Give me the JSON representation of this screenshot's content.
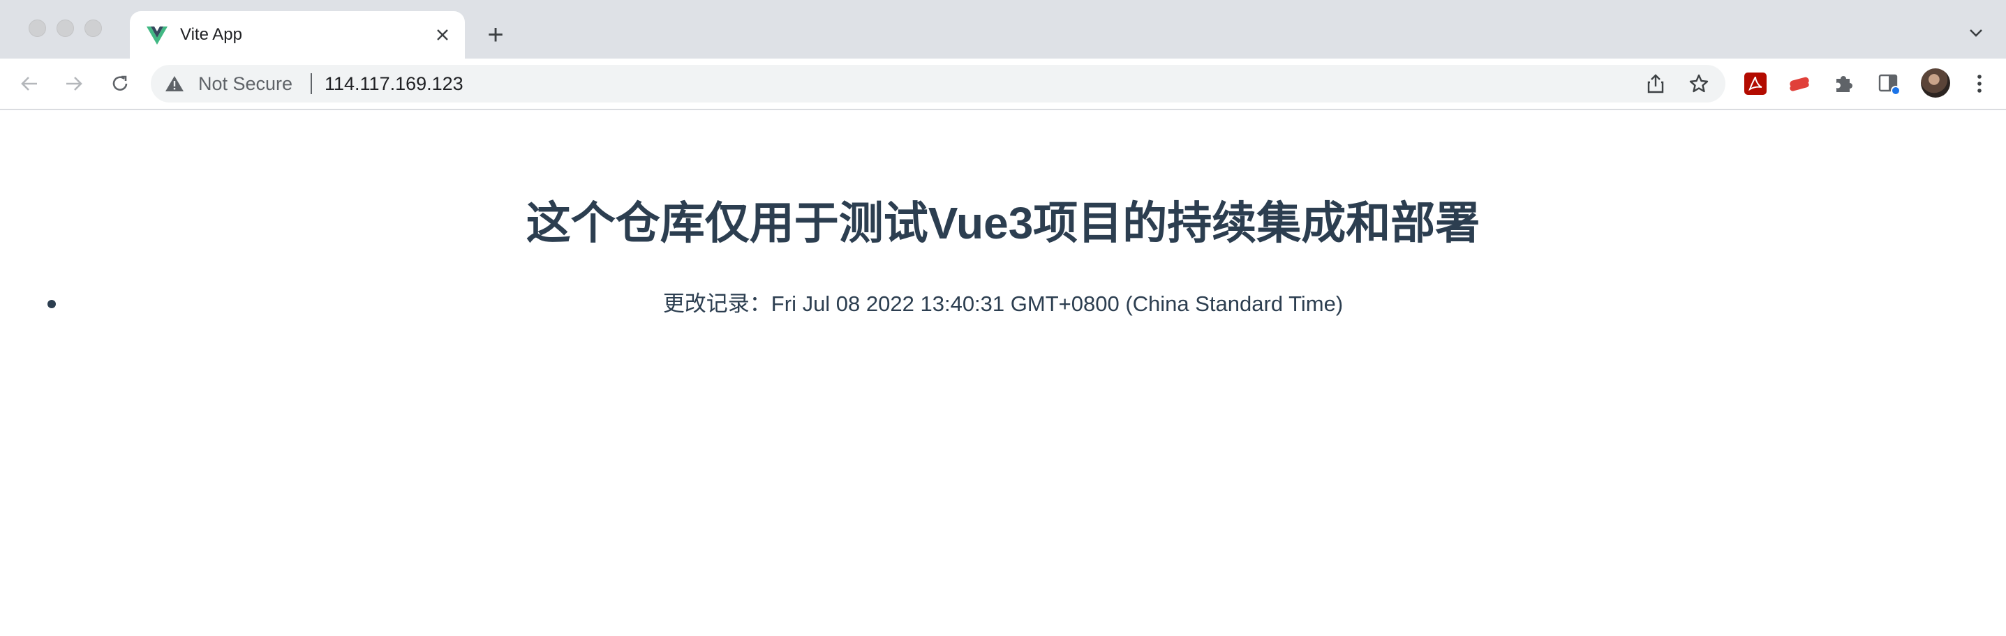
{
  "browser": {
    "tab": {
      "title": "Vite App",
      "favicon": "vue-logo-icon",
      "close_icon": "close-icon"
    },
    "new_tab_label": "+",
    "tab_menu_icon": "chevron-down-icon",
    "nav": {
      "back_icon": "back-arrow-icon",
      "forward_icon": "forward-arrow-icon",
      "reload_icon": "reload-icon"
    },
    "omnibox": {
      "security_label": "Not Secure",
      "security_icon": "warning-icon",
      "url": "114.117.169.123",
      "share_icon": "share-icon",
      "bookmark_icon": "star-icon"
    },
    "extensions": [
      {
        "name": "acrobat-icon",
        "color": "#b30b00"
      },
      {
        "name": "red-extension-icon",
        "color": "#e0403a"
      },
      {
        "name": "puzzle-icon",
        "color": "#5f6368"
      },
      {
        "name": "side-panel-icon",
        "color": "#1a73e8"
      }
    ],
    "menu_icon": "kebab-menu-icon"
  },
  "page": {
    "heading": "这个仓库仅用于测试Vue3项目的持续集成和部署",
    "change_log": "更改记录：Fri Jul 08 2022 13:40:31 GMT+0800 (China Standard Time)",
    "text_color": "#2c3e50"
  }
}
